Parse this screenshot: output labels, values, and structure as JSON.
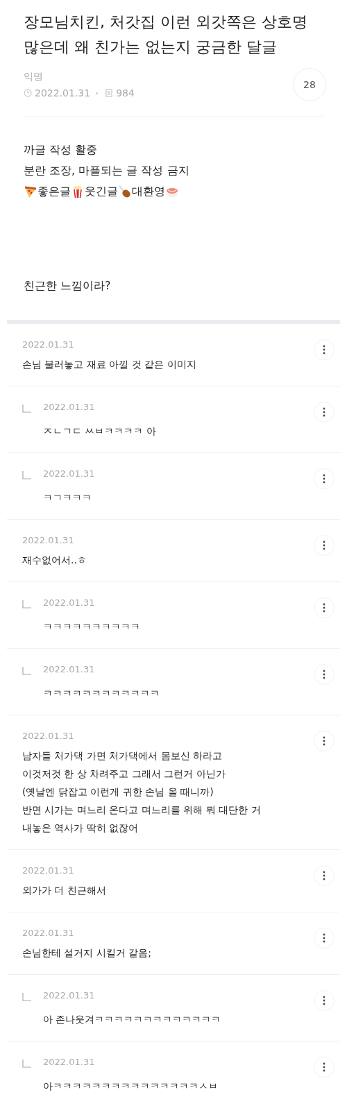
{
  "post": {
    "title": "장모님치킨, 처갓집 이런 외갓쪽은 상호명 많은데 왜 친가는 없는지 궁금한 달글",
    "author": "익명",
    "date": "2022.01.31",
    "views": "984",
    "comment_count": "28"
  },
  "notice": {
    "lines": [
      "까글 작성 활중",
      "분란 조장, 마플되는 글 작성 금지"
    ],
    "tags": [
      {
        "kind": "pizza",
        "label": "좋은글"
      },
      {
        "kind": "popcorn",
        "label": "웃긴글"
      },
      {
        "kind": "chicken",
        "label": "대환영"
      },
      {
        "kind": "sushi"
      }
    ]
  },
  "body": "친근한 느낌이라?",
  "comments": [
    {
      "reply": false,
      "date": "2022.01.31",
      "text": "손님 불러놓고 재료 아낄 것 같은 이미지"
    },
    {
      "reply": true,
      "date": "2022.01.31",
      "text": "ㅈㄴㄱㄷ ㅆㅂㅋㅋㅋㅋ 아"
    },
    {
      "reply": true,
      "date": "2022.01.31",
      "text": "ㅋㄱㅋㅋㅋ"
    },
    {
      "reply": false,
      "date": "2022.01.31",
      "text": "재수없어서..ㅎ"
    },
    {
      "reply": true,
      "date": "2022.01.31",
      "text": "ㅋㅋㅋㅋㅋㅋㅋㅋㅋㅋ"
    },
    {
      "reply": true,
      "date": "2022.01.31",
      "text": "ㅋㅋㅋㅋㅋㅋㅋㅋㅋㅋㅋㅋ"
    },
    {
      "reply": false,
      "date": "2022.01.31",
      "text": "남자들 처가댁 가면 처가댁에서 몸보신 하라고\n이것저것 한 상 차려주고 그래서 그런거 아닌가\n(옛날엔 닭잡고 이런게 귀한 손님 올 때니까)\n반면 시가는 며느리 온다고 며느리를 위해 뭐 대단한 거\n내놓은 역사가 딱히 없잖어"
    },
    {
      "reply": false,
      "date": "2022.01.31",
      "text": "외가가 더 친근해서"
    },
    {
      "reply": false,
      "date": "2022.01.31",
      "text": "손님한테 설거지 시킬거 같음;"
    },
    {
      "reply": true,
      "date": "2022.01.31",
      "text": "아 존나웃겨ㅋㅋㅋㅋㅋㅋㅋㅋㅋㅋㅋㅋㅋ"
    },
    {
      "reply": true,
      "date": "2022.01.31",
      "text": "아ㅋㅋㅋㅋㅋㅋㅋㅋㅋㅋㅋㅋㅋㅋㅋㅅㅂ"
    }
  ]
}
